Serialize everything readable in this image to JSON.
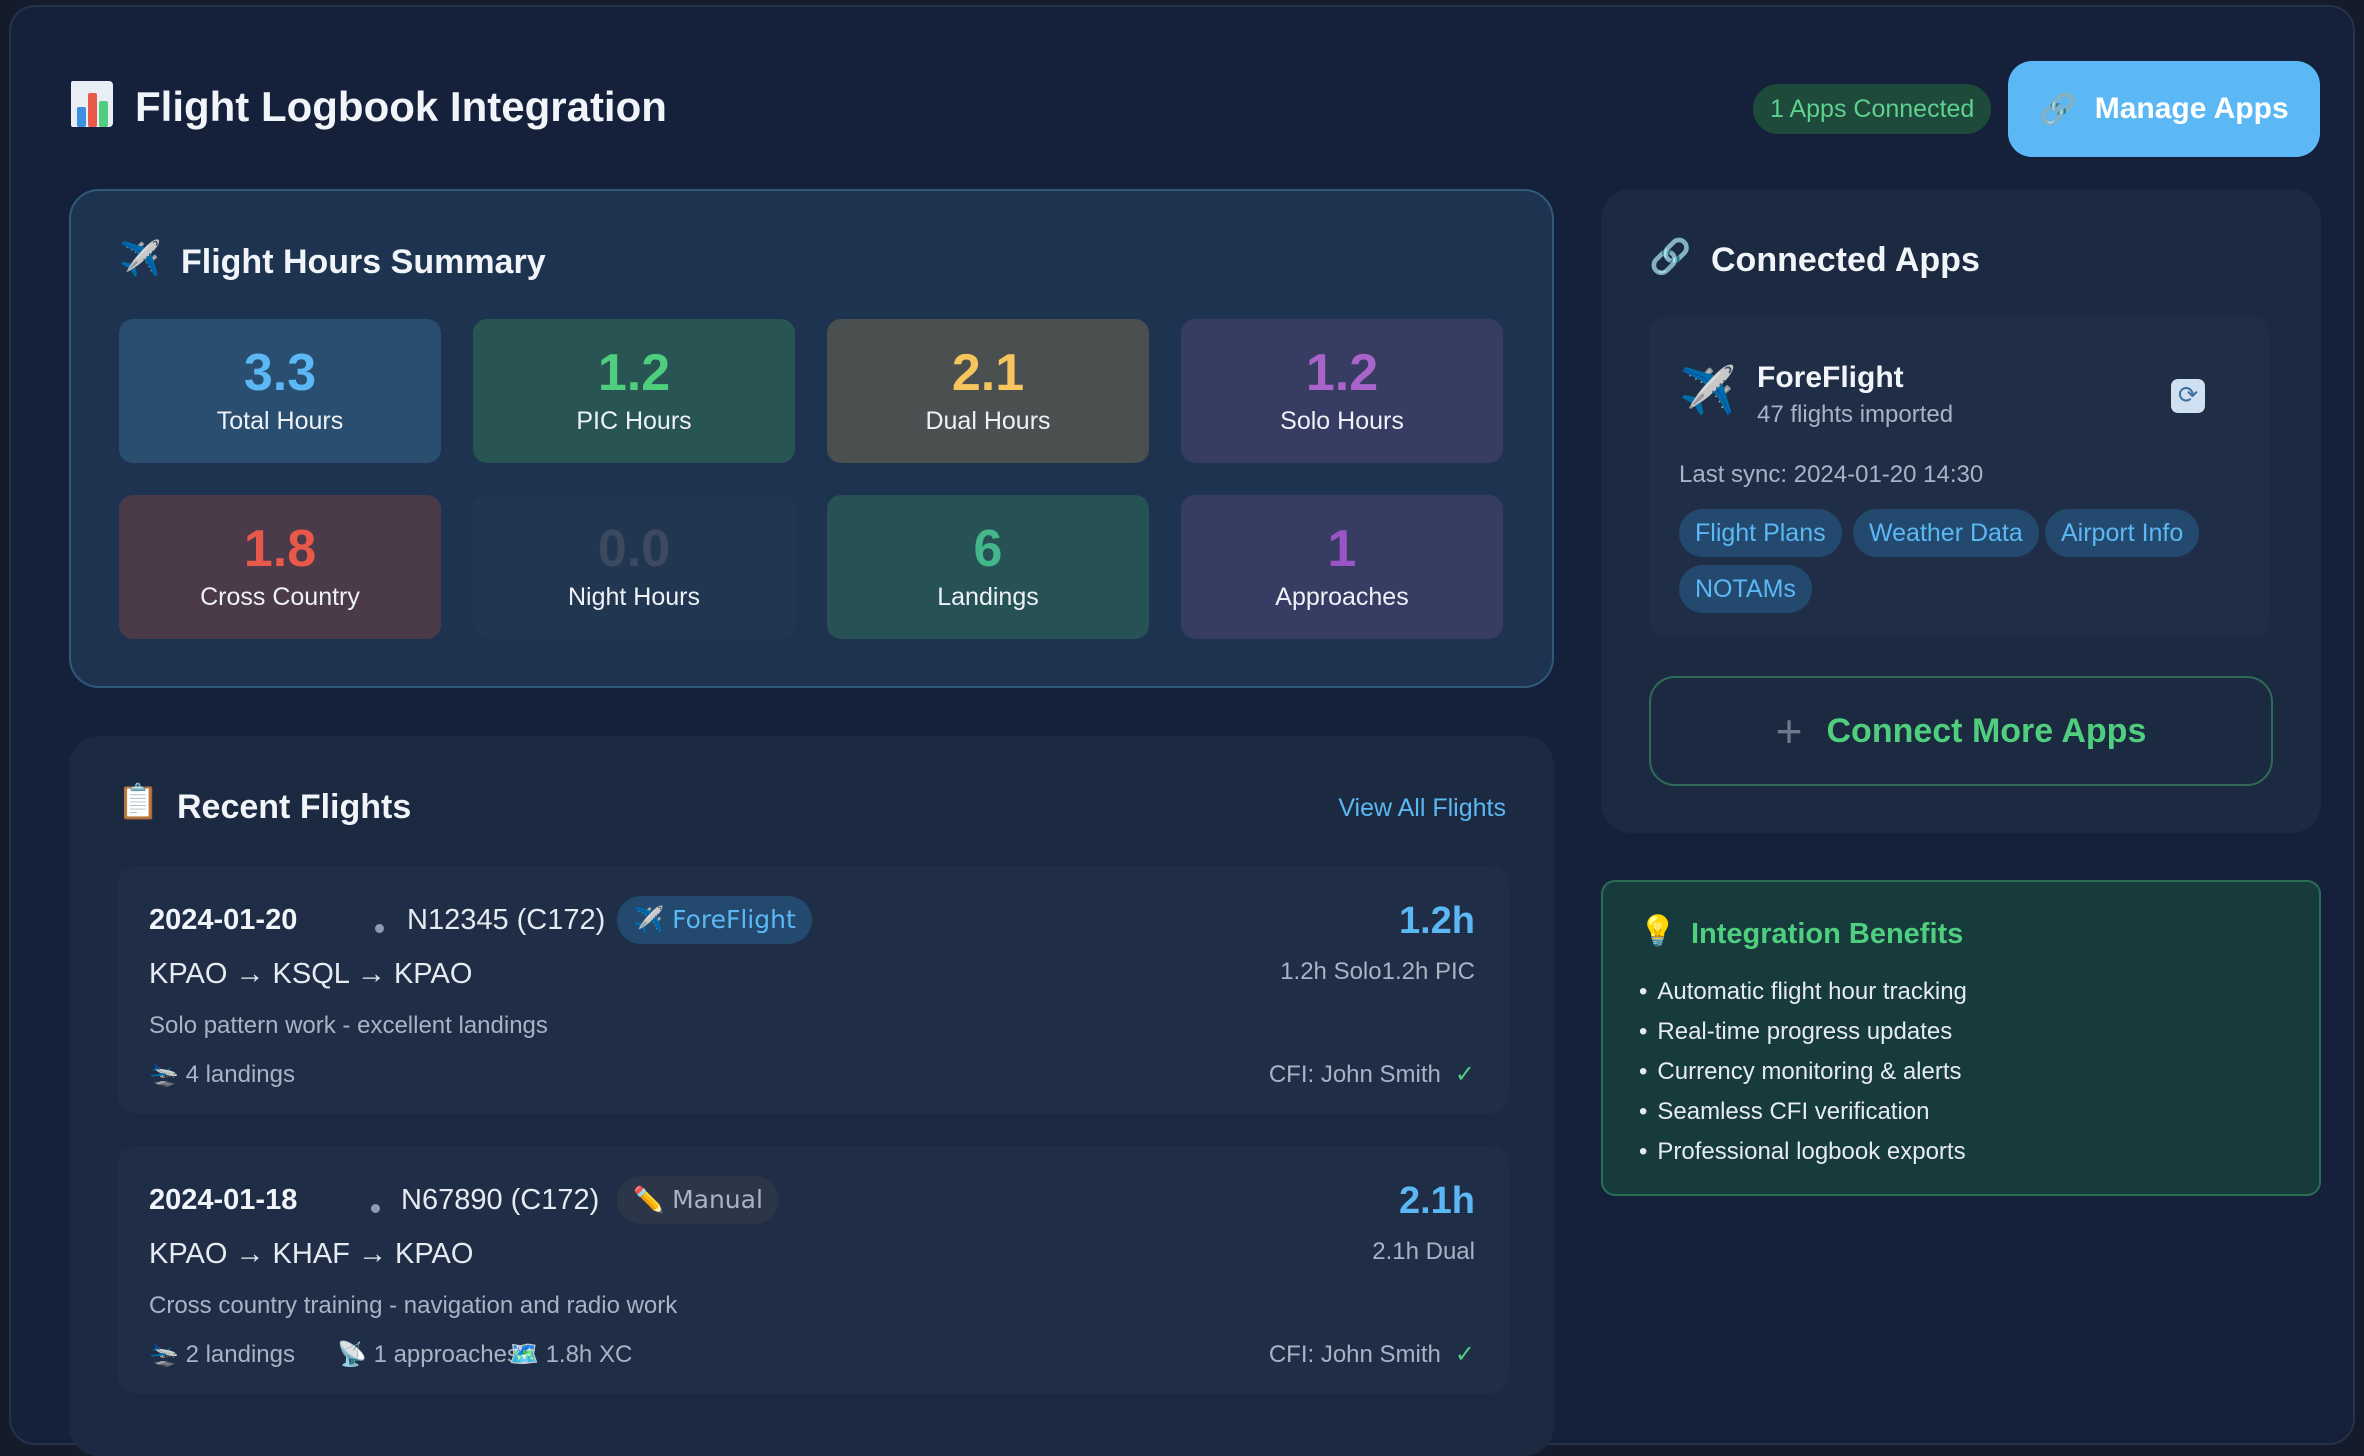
{
  "header": {
    "title": "Flight Logbook Integration",
    "icon": "bar-chart-icon",
    "connected_badge": "1 Apps Connected",
    "manage_label": "Manage Apps",
    "manage_icon": "link-icon"
  },
  "summary": {
    "title": "Flight Hours Summary",
    "icon": "airplane-icon",
    "stats": [
      {
        "value": "3.3",
        "label": "Total Hours",
        "color": "#5cb8f4"
      },
      {
        "value": "1.2",
        "label": "PIC Hours",
        "color": "#4fcf7e"
      },
      {
        "value": "2.1",
        "label": "Dual Hours",
        "color": "#f7c55d"
      },
      {
        "value": "1.2",
        "label": "Solo Hours",
        "color": "#a864c8"
      },
      {
        "value": "1.8",
        "label": "Cross Country",
        "color": "#e8594a"
      },
      {
        "value": "0.0",
        "label": "Night Hours",
        "color": "#3b4a60"
      },
      {
        "value": "6",
        "label": "Landings",
        "color": "#43b68a"
      },
      {
        "value": "1",
        "label": "Approaches",
        "color": "#9a55c4"
      }
    ]
  },
  "recent": {
    "title": "Recent Flights",
    "icon": "clipboard-icon",
    "view_all": "View All Flights",
    "flights": [
      {
        "date": "2024-01-20",
        "aircraft": "N12345 (C172)",
        "source": "✈️ ForeFlight",
        "route": "KPAO → KSQL → KPAO",
        "remarks": "Solo pattern work - excellent landings",
        "landings": "4 landings",
        "hours": "1.2h",
        "detail": "1.2h Solo1.2h PIC",
        "cfi": "CFI: John Smith",
        "check": "✓"
      },
      {
        "date": "2024-01-18",
        "aircraft": "N67890 (C172)",
        "source": "✏️ Manual",
        "route": "KPAO → KHAF → KPAO",
        "remarks": "Cross country training - navigation and radio work",
        "landings": "2 landings",
        "approaches": "1 approaches",
        "xc": "1.8h XC",
        "hours": "2.1h",
        "detail": "2.1h Dual",
        "cfi": "CFI: John Smith",
        "check": "✓"
      }
    ]
  },
  "apps": {
    "title": "Connected Apps",
    "icon": "link-icon",
    "app": {
      "name": "ForeFlight",
      "imported": "47 flights imported",
      "last_sync": "Last sync: 2024-01-20 14:30",
      "tags": [
        "Flight Plans",
        "Weather Data",
        "Airport Info",
        "NOTAMs"
      ]
    },
    "connect_more": "Connect More Apps"
  },
  "benefits": {
    "title": "Integration Benefits",
    "icon": "lightbulb-icon",
    "items": [
      "Automatic flight hour tracking",
      "Real-time progress updates",
      "Currency monitoring & alerts",
      "Seamless CFI verification",
      "Professional logbook exports"
    ]
  }
}
